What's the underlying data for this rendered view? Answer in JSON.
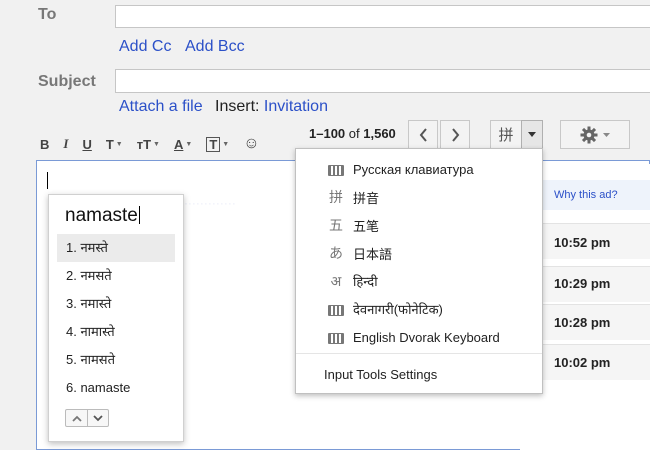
{
  "compose": {
    "to_label": "To",
    "to_value": "",
    "add_cc": "Add Cc",
    "add_bcc": "Add Bcc",
    "subject_label": "Subject",
    "subject_value": "",
    "attach_file": "Attach a file",
    "insert_label": "Insert:",
    "insert_invitation": "Invitation"
  },
  "toolbar": {
    "bold": "B",
    "italic": "I",
    "underline": "U",
    "font": "T",
    "size": "тT",
    "text_color": "A",
    "background_color": "T",
    "emoji": "☺"
  },
  "ime": {
    "input_text": "namaste",
    "suggestions": [
      "1. नमस्ते",
      "2. नमसते",
      "3. नमास्ते",
      "4. नामास्ते",
      "5. नामसते",
      "6. namaste"
    ],
    "selected_index": 0
  },
  "pager": {
    "range": "1–100",
    "of": "of",
    "total": "1,560"
  },
  "input_tools_button": {
    "glyph": "拼"
  },
  "input_tools_menu": {
    "items": [
      {
        "icon": "keyboard-icon",
        "glyph": "",
        "label": "Русская клавиатура"
      },
      {
        "icon": "pinyin-icon",
        "glyph": "拼",
        "label": "拼音"
      },
      {
        "icon": "wubi-icon",
        "glyph": "五",
        "label": "五笔"
      },
      {
        "icon": "hiragana-icon",
        "glyph": "あ",
        "label": "日本語"
      },
      {
        "icon": "devanagari-icon",
        "glyph": "अ",
        "label": "हिन्दी"
      },
      {
        "icon": "keyboard-icon",
        "glyph": "",
        "label": "देवनागरी(फोनेटिक)"
      },
      {
        "icon": "keyboard-icon",
        "glyph": "",
        "label": "English Dvorak Keyboard"
      }
    ],
    "settings_label": "Input Tools Settings"
  },
  "mail_list": {
    "why_ad": "Why this ad?",
    "times": [
      "10:52 pm",
      "10:29 pm",
      "10:28 pm",
      "10:02 pm"
    ]
  }
}
